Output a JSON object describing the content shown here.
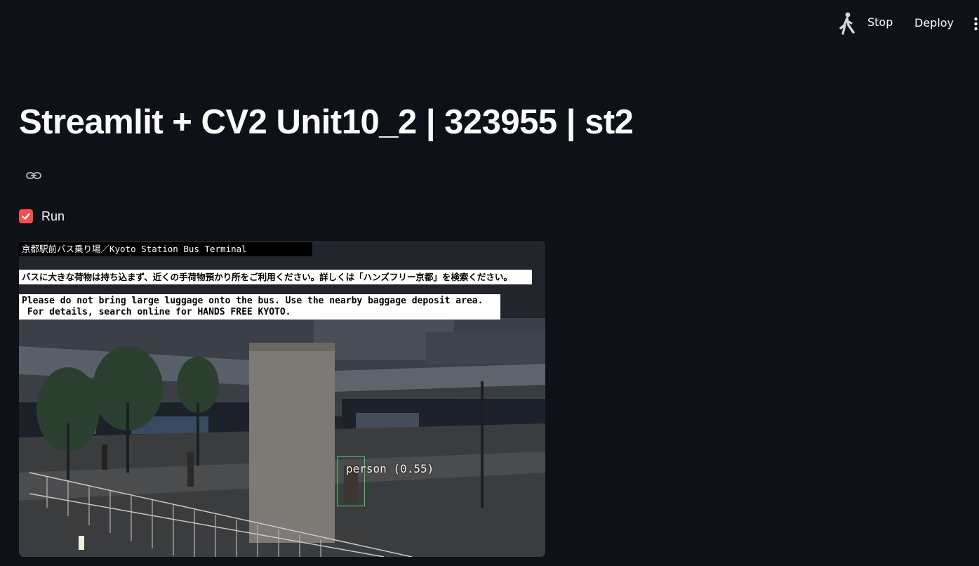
{
  "toolbar": {
    "stop_label": "Stop",
    "deploy_label": "Deploy",
    "running_icon": "running-person-icon",
    "menu_icon": "kebab-menu-icon"
  },
  "main": {
    "title": "Streamlit + CV2 Unit10_2 | 323955 | st2",
    "anchor_icon": "link-icon",
    "run_checkbox": {
      "label": "Run",
      "checked": true
    }
  },
  "video": {
    "camera_label": "京都駅前バス乗り場／Kyoto Station Bus Terminal",
    "notice_jp": "バスに大きな荷物は持ち込まず、近くの手荷物預かり所をご利用ください。詳しくは「ハンズフリー京都」を検索ください。",
    "notice_en": "Please do not bring large luggage onto the bus. Use the nearby baggage deposit area.\n For details, search online for HANDS FREE KYOTO.",
    "detection_label": "person (0.55)"
  },
  "colors": {
    "background": "#0e1117",
    "accent": "#ff4b4b",
    "detection_box": "#3ecf6a"
  }
}
